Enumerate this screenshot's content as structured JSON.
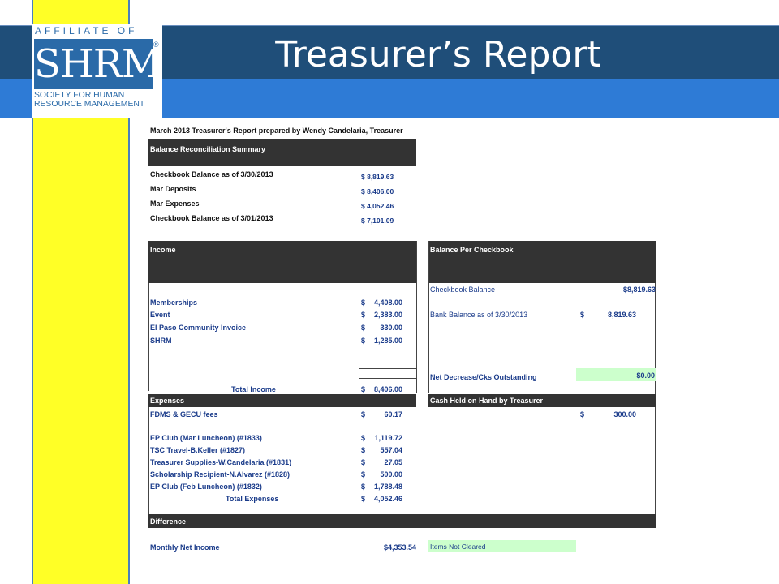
{
  "slide": {
    "title": "Treasurer’s Report",
    "colors": {
      "header_dark": "#1f4e79",
      "header_blue": "#2e7bd6",
      "side_bar": "#ffff26",
      "table_header": "#333333",
      "highlight_green": "#ccffcc"
    }
  },
  "logo": {
    "affiliate": "AFFILIATE OF",
    "brand": "SHRM",
    "registered": "®",
    "line1": "SOCIETY FOR HUMAN",
    "line2": "RESOURCE MANAGEMENT"
  },
  "report": {
    "heading": "March 2013 Treasurer's Report prepared by Wendy Candelaria, Treasurer",
    "reconciliation": {
      "header": "Balance Reconciliation Summary",
      "rows": [
        {
          "label": "Checkbook Balance as of 3/30/2013",
          "value": "$   8,819.63"
        },
        {
          "label": "Mar Deposits",
          "value": "$   8,406.00"
        },
        {
          "label": "Mar Expenses",
          "value": "$   4,052.46"
        },
        {
          "label": "Checkbook Balance as of 3/01/2013",
          "value": "$   7,101.09"
        }
      ]
    },
    "income": {
      "header": "Income",
      "rows": [
        {
          "label": "Memberships",
          "dollar": "$",
          "value": "4,408.00"
        },
        {
          "label": "Event",
          "dollar": "$",
          "value": "2,383.00"
        },
        {
          "label": "El Paso Community Invoice",
          "dollar": "$",
          "value": "330.00"
        },
        {
          "label": "SHRM",
          "dollar": "$",
          "value": "1,285.00"
        }
      ],
      "total_label": "Total Income",
      "total_dollar": "$",
      "total_value": "8,406.00"
    },
    "balance_per_checkbook": {
      "header": "Balance Per Checkbook",
      "checkbook_label": "Checkbook Balance",
      "checkbook_value": "$8,819.63",
      "bank_label": "Bank Balance as of 3/30/2013",
      "bank_dollar": "$",
      "bank_value": "8,819.63",
      "net_label": "Net Decrease/Cks Outstanding",
      "net_value": "$0.00"
    },
    "expenses": {
      "header": "Expenses",
      "rows": [
        {
          "label": "FDMS & GECU fees",
          "dollar": "$",
          "value": "60.17"
        },
        {
          "label": "EP Club (Mar Luncheon) (#1833)",
          "dollar": "$",
          "value": "1,119.72"
        },
        {
          "label": "TSC Travel-B.Keller (#1827)",
          "dollar": "$",
          "value": "557.04"
        },
        {
          "label": "Treasurer Supplies-W.Candelaria (#1831)",
          "dollar": "$",
          "value": "27.05"
        },
        {
          "label": "Scholarship Recipient-N.Alvarez (#1828)",
          "dollar": "$",
          "value": "500.00"
        },
        {
          "label": "EP Club (Feb Luncheon) (#1832)",
          "dollar": "$",
          "value": "1,788.48"
        }
      ],
      "total_label": "Total Expenses",
      "total_dollar": "$",
      "total_value": "4,052.46"
    },
    "cash_on_hand": {
      "header": "Cash Held on Hand by Treasurer",
      "dollar": "$",
      "value": "300.00"
    },
    "difference": {
      "header": "Difference",
      "net_income_label": "Monthly Net Income",
      "net_income_value": "$4,353.54",
      "items_not_cleared": "Items Not Cleared"
    }
  }
}
